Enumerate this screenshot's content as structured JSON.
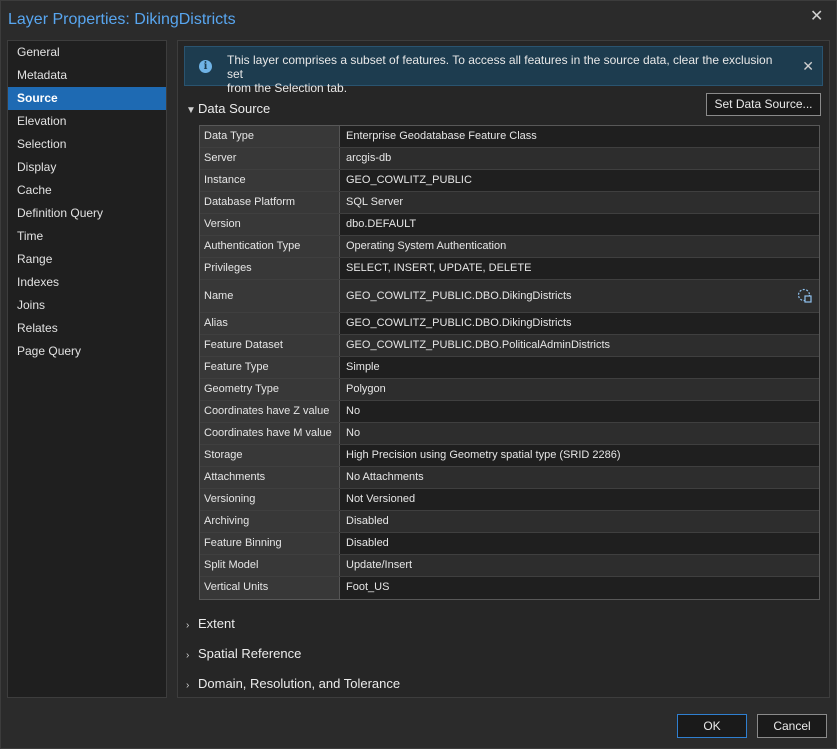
{
  "window": {
    "title": "Layer Properties: DikingDistricts"
  },
  "sidebar": {
    "items": [
      {
        "label": "General"
      },
      {
        "label": "Metadata"
      },
      {
        "label": "Source",
        "active": true
      },
      {
        "label": "Elevation"
      },
      {
        "label": "Selection"
      },
      {
        "label": "Display"
      },
      {
        "label": "Cache"
      },
      {
        "label": "Definition Query"
      },
      {
        "label": "Time"
      },
      {
        "label": "Range"
      },
      {
        "label": "Indexes"
      },
      {
        "label": "Joins"
      },
      {
        "label": "Relates"
      },
      {
        "label": "Page Query"
      }
    ]
  },
  "info": {
    "line1": "This layer comprises a subset of features. To access all features in the source data, clear the exclusion set",
    "line2": "from the Selection tab."
  },
  "data_source": {
    "header": "Data Source",
    "set_button": "Set Data Source...",
    "rows": [
      {
        "key": "Data Type",
        "value": "Enterprise Geodatabase Feature Class"
      },
      {
        "key": "Server",
        "value": "arcgis-db"
      },
      {
        "key": "Instance",
        "value": "GEO_COWLITZ_PUBLIC"
      },
      {
        "key": "Database Platform",
        "value": "SQL Server"
      },
      {
        "key": "Version",
        "value": "dbo.DEFAULT"
      },
      {
        "key": "Authentication Type",
        "value": "Operating System Authentication"
      },
      {
        "key": "Privileges",
        "value": "SELECT, INSERT, UPDATE, DELETE"
      },
      {
        "key": "Name",
        "value": "GEO_COWLITZ_PUBLIC.DBO.DikingDistricts"
      },
      {
        "key": "Alias",
        "value": "GEO_COWLITZ_PUBLIC.DBO.DikingDistricts"
      },
      {
        "key": "Feature Dataset",
        "value": "GEO_COWLITZ_PUBLIC.DBO.PoliticalAdminDistricts"
      },
      {
        "key": "Feature Type",
        "value": "Simple"
      },
      {
        "key": "Geometry Type",
        "value": "Polygon"
      },
      {
        "key": "Coordinates have Z value",
        "value": "No"
      },
      {
        "key": "Coordinates have M value",
        "value": "No"
      },
      {
        "key": "Storage",
        "value": "High Precision using Geometry spatial type (SRID 2286)"
      },
      {
        "key": "Attachments",
        "value": "No Attachments"
      },
      {
        "key": "Versioning",
        "value": "Not Versioned"
      },
      {
        "key": "Archiving",
        "value": "Disabled"
      },
      {
        "key": "Feature Binning",
        "value": "Disabled"
      },
      {
        "key": "Split Model",
        "value": "Update/Insert"
      },
      {
        "key": "Vertical Units",
        "value": "Foot_US"
      }
    ]
  },
  "sections": {
    "extent": "Extent",
    "spatial_reference": "Spatial Reference",
    "domain": "Domain, Resolution, and Tolerance"
  },
  "footer": {
    "ok": "OK",
    "cancel": "Cancel"
  },
  "icons": {
    "close": "close-icon",
    "info": "info-icon",
    "copy": "copy-icon",
    "chevron": "chevron-icon"
  },
  "colors": {
    "accent": "#1e6ab3",
    "title": "#58a6f0",
    "info_bg": "#1d3c4f"
  }
}
